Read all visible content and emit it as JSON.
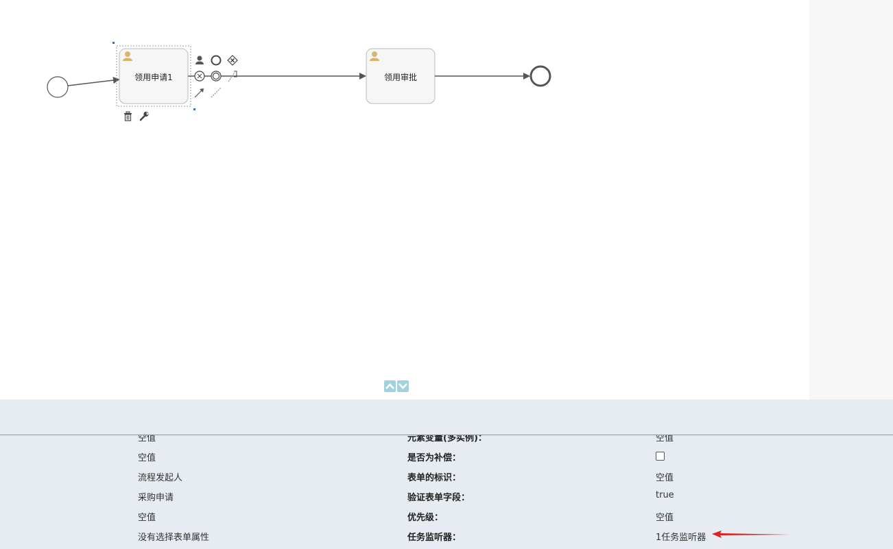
{
  "diagram": {
    "tasks": [
      {
        "id": "task1",
        "label": "领用申请1"
      },
      {
        "id": "task2",
        "label": "领用审批"
      }
    ]
  },
  "toolbar": {
    "palette_icons": [
      "user-task-icon",
      "event-icon",
      "gateway-icon",
      "intermediate-event-icon",
      "boundary-event-icon",
      "annotation-icon",
      "connection-icon",
      "association-icon"
    ],
    "delete_icon": "trash-icon",
    "config_icon": "wrench-icon"
  },
  "panel_toggle": {
    "up": "collapse-up-icon",
    "down": "expand-down-icon",
    "color": "#9fd3de"
  },
  "properties": {
    "rows": [
      {
        "col1": "空值",
        "col2": "元素变量(多实例)：",
        "col3": "空值"
      },
      {
        "col1": "空值",
        "col2": "是否为补偿：",
        "col3": ""
      },
      {
        "col1": "流程发起人",
        "col2": "表单的标识：",
        "col3": "空值"
      },
      {
        "col1": "采购申请",
        "col2": "验证表单字段：",
        "col3": "true"
      },
      {
        "col1": "空值",
        "col2": "优先级：",
        "col3": "空值"
      },
      {
        "col1": "没有选择表单属性",
        "col2": "任务监听器：",
        "col3": "1任务监听器"
      }
    ]
  },
  "colors": {
    "panel_bg": "#e6ecf1",
    "user_icon": "#d9b46a",
    "annotation_arrow": "#e02020"
  }
}
